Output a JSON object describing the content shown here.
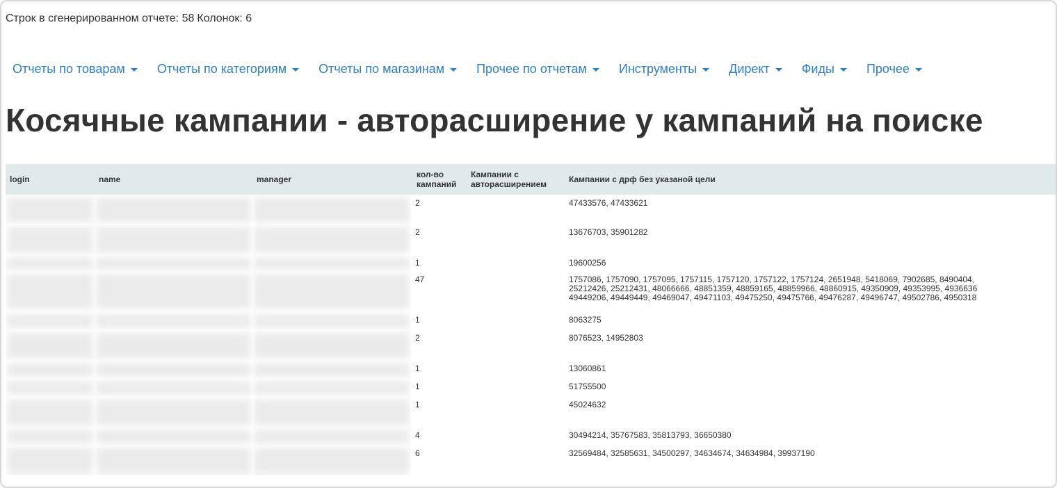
{
  "summary": {
    "rows_label": "Строк в сгенерированном отчете: 58",
    "cols_label": "Колонок: 6"
  },
  "nav": {
    "items": [
      {
        "label": "Отчеты по товарам"
      },
      {
        "label": "Отчеты по категориям"
      },
      {
        "label": "Отчеты по магазинам"
      },
      {
        "label": "Прочее по отчетам"
      },
      {
        "label": "Инструменты"
      },
      {
        "label": "Директ"
      },
      {
        "label": "Фиды"
      },
      {
        "label": "Прочее"
      }
    ]
  },
  "page": {
    "title": "Косячные кампании - авторасширение у кампаний на поиске"
  },
  "table": {
    "headers": {
      "login": "login",
      "name": "name",
      "manager": "manager",
      "count_line1": "кол-во",
      "count_line2": "кампаний",
      "auto_line1": "Кампании с",
      "auto_line2": "авторасширением",
      "drf": "Кампании с дрф без указаной цели"
    },
    "rows": [
      {
        "count": "2",
        "auto": "",
        "drf": [
          "47433576, 47433621"
        ]
      },
      {
        "count": "2",
        "auto": "",
        "drf": [
          "13676703, 35901282"
        ]
      },
      {
        "count": "1",
        "auto": "",
        "drf": [
          "19600256"
        ]
      },
      {
        "count": "47",
        "auto": "",
        "drf": [
          "1757086, 1757090, 1757095, 1757115, 1757120, 1757122, 1757124, 2651948, 5418069, 7902685, 8490404,",
          "25212426, 25212431, 48066666, 48851359, 48859165, 48859966, 48860915, 49350909, 49353995, 4936636",
          "49449206, 49449449, 49469047, 49471103, 49475250, 49475766, 49476287, 49496747, 49502786, 4950318"
        ]
      },
      {
        "count": "1",
        "auto": "",
        "drf": [
          "8063275"
        ]
      },
      {
        "count": "2",
        "auto": "",
        "drf": [
          "8076523, 14952803"
        ]
      },
      {
        "count": "1",
        "auto": "",
        "drf": [
          "13060861"
        ]
      },
      {
        "count": "1",
        "auto": "",
        "drf": [
          "51755500"
        ]
      },
      {
        "count": "1",
        "auto": "",
        "drf": [
          "45024632"
        ]
      },
      {
        "count": "4",
        "auto": "",
        "drf": [
          "30494214, 35767583, 35813793, 36650380"
        ]
      },
      {
        "count": "6",
        "auto": "",
        "drf": [
          "32569484, 32585631, 34500297, 34634674, 34634984, 39937190"
        ]
      }
    ]
  }
}
